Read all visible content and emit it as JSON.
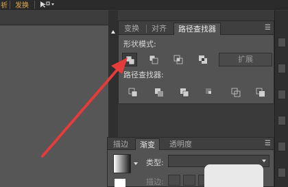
{
  "topbar": {
    "items": [
      "祈",
      "发换"
    ],
    "tool_icon": "selection-tool-icon"
  },
  "pathfinder_panel": {
    "tabs": [
      "变换",
      "对齐",
      "路径查找器"
    ],
    "active_tab": "路径查找器",
    "shape_modes_label": "形状模式:",
    "expand_label": "扩展",
    "pathfinders_label": "路径查找器:",
    "shape_mode_icons": [
      "unite-icon",
      "minus-front-icon",
      "intersect-icon",
      "exclude-icon"
    ],
    "pathfinder_icons": [
      "divide-icon",
      "trim-icon",
      "merge-icon",
      "crop-icon",
      "outline-icon",
      "minus-back-icon"
    ]
  },
  "gradient_panel": {
    "tabs": [
      "描边",
      "渐变",
      "透明度"
    ],
    "active_tab": "渐变",
    "type_label": "类型:",
    "stroke_label": "描边:"
  },
  "colors": {
    "annotation_arrow": "#e63b3b",
    "panel_bg": "#535353",
    "topbar_accent": "#e0a84b"
  }
}
